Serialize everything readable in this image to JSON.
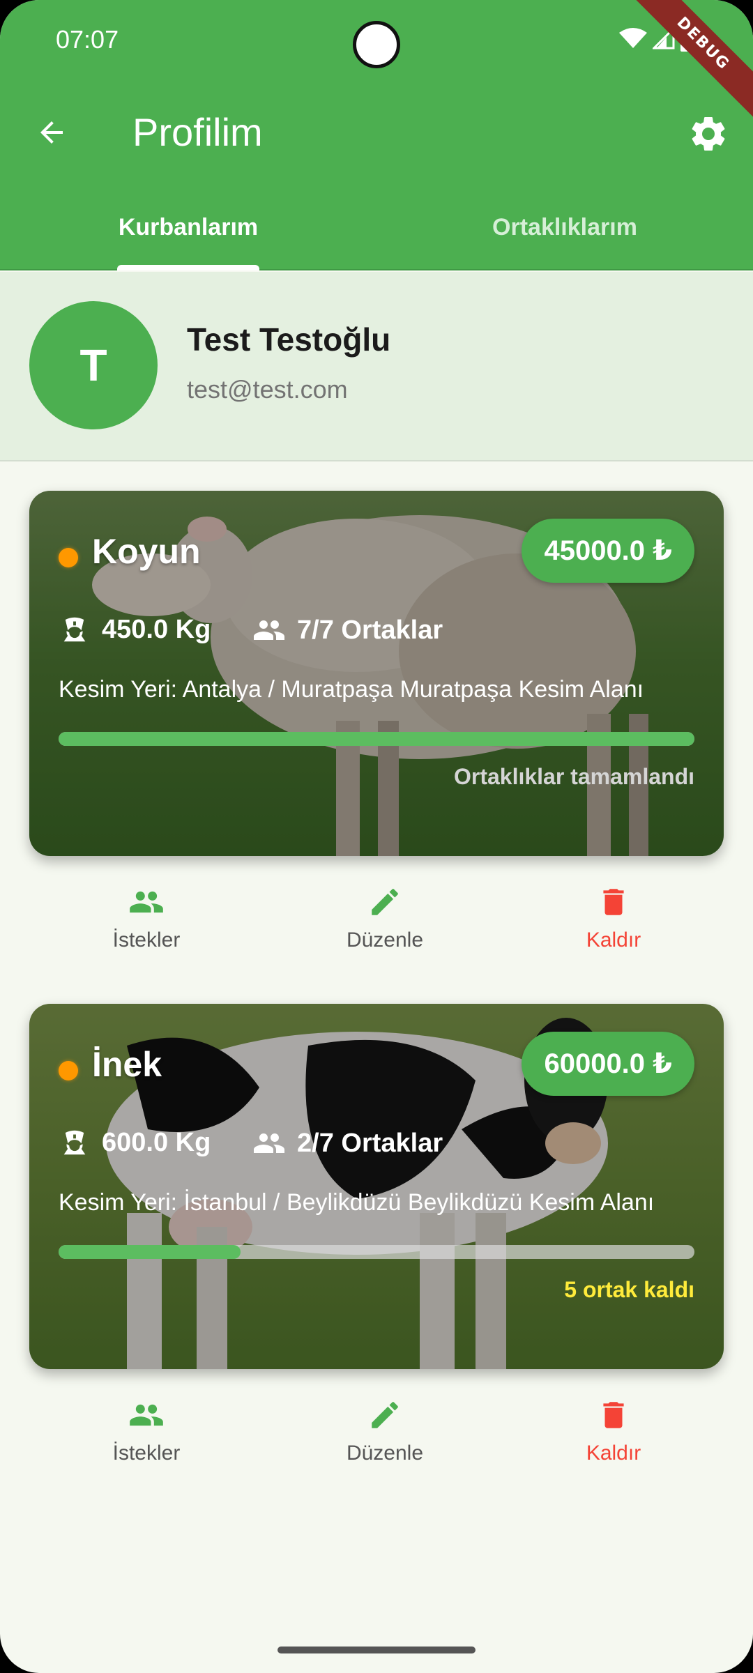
{
  "status_bar": {
    "time": "07:07",
    "icons": [
      "wifi-icon",
      "signal-icon",
      "battery-icon"
    ]
  },
  "debug_banner": "DEBUG",
  "app_bar": {
    "title": "Profilim",
    "back_icon": "arrow-back-icon",
    "settings_icon": "gear-icon"
  },
  "tabs": [
    {
      "label": "Kurbanlarım",
      "selected": true
    },
    {
      "label": "Ortaklıklarım",
      "selected": false
    }
  ],
  "profile": {
    "initial": "T",
    "name": "Test Testoğlu",
    "email": "test@test.com"
  },
  "cards": [
    {
      "animal": "Koyun",
      "price": "45000.0 ₺",
      "weight": "450.0 Kg",
      "partners": "7/7 Ortaklar",
      "location": "Kesim Yeri: Antalya / Muratpaşa Muratpaşa Kesim Alanı",
      "progress": 1.0,
      "status_text": "Ortaklıklar tamamlandı"
    },
    {
      "animal": "İnek",
      "price": "60000.0 ₺",
      "weight": "600.0 Kg",
      "partners": "2/7 Ortaklar",
      "location": "Kesim Yeri: İstanbul / Beylikdüzü Beylikdüzü Kesim Alanı",
      "progress": 0.2857,
      "status_text": "5 ortak kaldı"
    }
  ],
  "actions": {
    "requests": "İstekler",
    "edit": "Düzenle",
    "remove": "Kaldır"
  },
  "colors": {
    "primary": "#4caf50",
    "danger": "#f44336",
    "warning": "#ffeb3b",
    "dot": "#ff9800"
  }
}
